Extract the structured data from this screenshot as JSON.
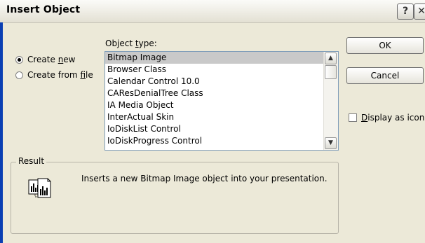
{
  "window": {
    "title": "Insert Object",
    "help_glyph": "?",
    "close_glyph": "✕"
  },
  "options": {
    "create_new": {
      "label": "Create new",
      "selected": true
    },
    "create_from_file": {
      "label": "Create from file",
      "selected": false
    }
  },
  "object_type": {
    "label": "Object type:",
    "items": [
      "Bitmap Image",
      "Browser Class",
      "Calendar Control 10.0",
      "CAResDenialTree Class",
      "IA Media Object",
      "InterActual Skin",
      "IoDiskList Control",
      "IoDiskProgress Control"
    ],
    "selected_index": 0
  },
  "buttons": {
    "ok": "OK",
    "cancel": "Cancel"
  },
  "display_as_icon": {
    "label": "Display as icon",
    "checked": false
  },
  "result": {
    "legend": "Result",
    "text": "Inserts a new Bitmap Image object into your presentation.",
    "icon": "embedded-object-icon"
  },
  "colors": {
    "dialog_bg": "#ece9d8",
    "title_border": "#0b3fb3",
    "selection": "#c9c9c9"
  }
}
